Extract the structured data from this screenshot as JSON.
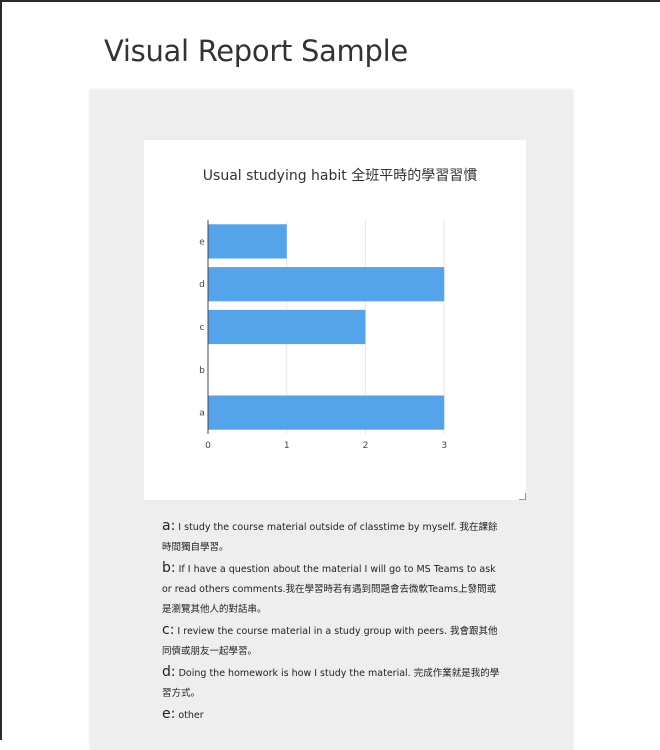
{
  "page": {
    "title": "Visual Report Sample"
  },
  "chart_data": {
    "type": "bar",
    "orientation": "horizontal",
    "title": "Usual studying habit 全班平時的學習習慣",
    "categories": [
      "a",
      "b",
      "c",
      "d",
      "e"
    ],
    "values": [
      3,
      0,
      2,
      3,
      1
    ],
    "xticks": [
      0,
      1,
      2,
      3
    ],
    "xlim": [
      0,
      3.15
    ],
    "xlabel": "",
    "ylabel": "",
    "grid": true,
    "bar_color": "#55a3e8"
  },
  "legend": [
    {
      "key": "a:",
      "text": "I study the course material outside of classtime by myself. 我在課餘時間獨自學習。"
    },
    {
      "key": "b:",
      "text": "If I have a question about the material I will go to MS Teams to ask or read others comments.我在學習時若有遇到問題會去微軟Teams上發問或是瀏覽其他人的對話串。"
    },
    {
      "key": "c:",
      "text": "I review the course material in a study group with peers. 我會跟其他同儕或朋友一起學習。"
    },
    {
      "key": "d:",
      "text": "Doing the homework is how I study the material. 完成作業就是我的學習方式。"
    },
    {
      "key": "e:",
      "text": "other"
    }
  ]
}
